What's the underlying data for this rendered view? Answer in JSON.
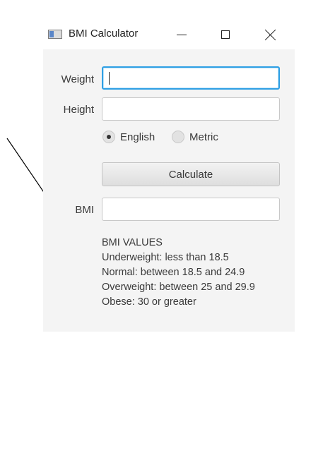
{
  "window": {
    "title": "BMI Calculator"
  },
  "form": {
    "weight_label": "Weight",
    "weight_value": "",
    "height_label": "Height",
    "height_value": "",
    "units": {
      "options": [
        "English",
        "Metric"
      ],
      "selected": "English"
    },
    "calculate_label": "Calculate",
    "bmi_label": "BMI",
    "bmi_value": ""
  },
  "bmi_values": {
    "heading": "BMI VALUES",
    "lines": [
      "Underweight: less than 18.5",
      "Normal: between 18.5 and 24.9",
      "Overweight: between 25 and 29.9",
      "Obese: 30 or greater"
    ]
  },
  "colors": {
    "focus_border": "#2f9fe4",
    "window_background": "#f4f4f4"
  }
}
